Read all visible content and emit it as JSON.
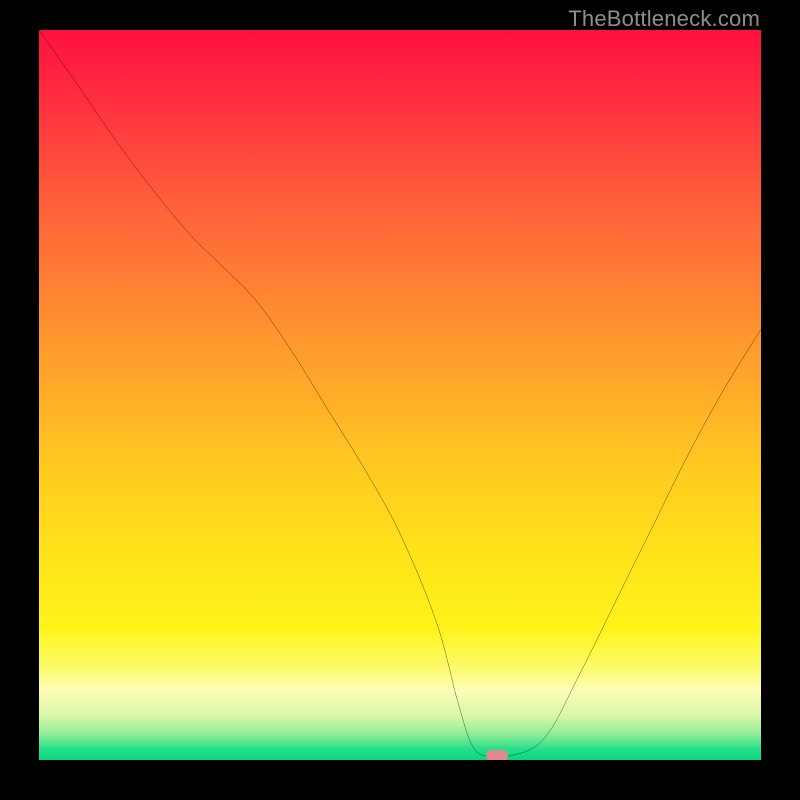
{
  "watermark": "TheBottleneck.com",
  "chart_data": {
    "type": "line",
    "title": "",
    "xlabel": "",
    "ylabel": "",
    "xlim": [
      0,
      100
    ],
    "ylim": [
      0,
      100
    ],
    "background_gradient": [
      {
        "stop": 0.0,
        "color": "#ff113e"
      },
      {
        "stop": 0.1,
        "color": "#ff2f3f"
      },
      {
        "stop": 0.22,
        "color": "#ff5a3b"
      },
      {
        "stop": 0.35,
        "color": "#ff8133"
      },
      {
        "stop": 0.48,
        "color": "#ffa72a"
      },
      {
        "stop": 0.6,
        "color": "#ffca20"
      },
      {
        "stop": 0.72,
        "color": "#ffe31a"
      },
      {
        "stop": 0.82,
        "color": "#fff41a"
      },
      {
        "stop": 0.87,
        "color": "#fbfb63"
      },
      {
        "stop": 0.905,
        "color": "#fdfdb8"
      },
      {
        "stop": 0.94,
        "color": "#d8f7a6"
      },
      {
        "stop": 0.965,
        "color": "#8eec9a"
      },
      {
        "stop": 0.985,
        "color": "#27df88"
      },
      {
        "stop": 1.0,
        "color": "#05d97f"
      }
    ],
    "series": [
      {
        "name": "bottleneck-curve",
        "x": [
          0,
          5,
          12,
          20,
          25,
          30,
          35,
          40,
          45,
          50,
          55,
          58,
          60,
          62,
          65,
          70,
          75,
          80,
          85,
          90,
          95,
          100
        ],
        "y": [
          100,
          93,
          83,
          73,
          68,
          63,
          56,
          48,
          40,
          31,
          19,
          8,
          2,
          0.5,
          0.5,
          3,
          12,
          22,
          32,
          42,
          51,
          59
        ]
      }
    ],
    "marker": {
      "x": 63.5,
      "y": 0.6,
      "shape": "pill",
      "color": "#e58a8c"
    }
  }
}
